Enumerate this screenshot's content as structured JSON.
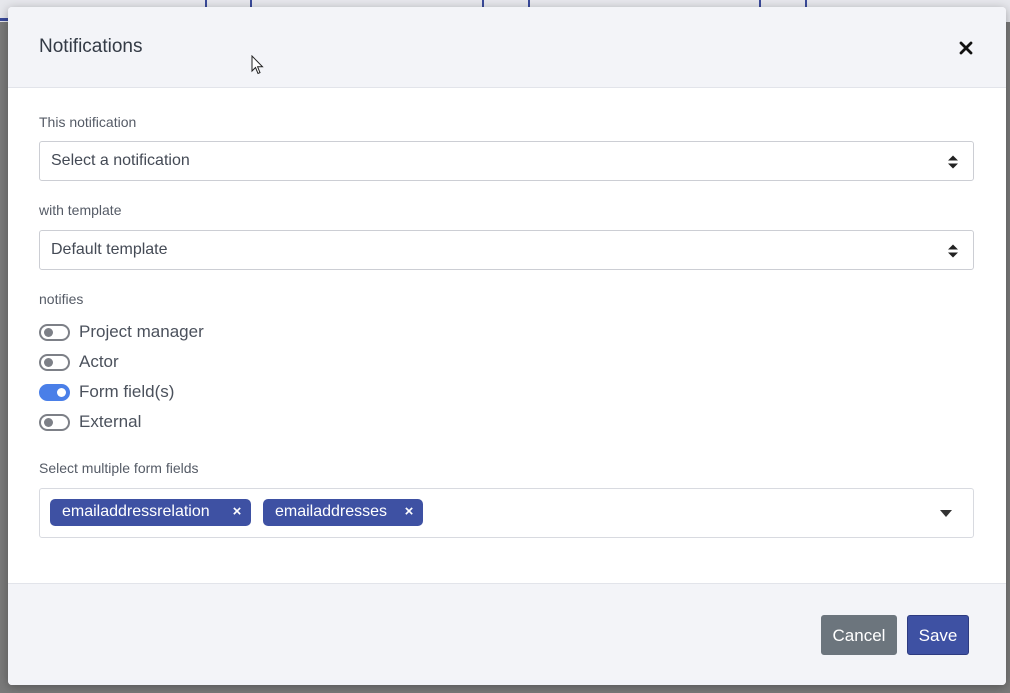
{
  "modal": {
    "title": "Notifications",
    "close_icon": "close-icon"
  },
  "notification": {
    "label": "This notification",
    "value": "Select a notification"
  },
  "template": {
    "label": "with template",
    "value": "Default template"
  },
  "notifies": {
    "label": "notifies",
    "options": [
      {
        "label": "Project manager",
        "checked": false
      },
      {
        "label": "Actor",
        "checked": false
      },
      {
        "label": "Form field(s)",
        "checked": true
      },
      {
        "label": "External",
        "checked": false
      }
    ]
  },
  "form_fields": {
    "label": "Select multiple form fields",
    "tags": [
      "emailaddressrelation",
      "emailaddresses"
    ],
    "remove_symbol": "×"
  },
  "footer": {
    "cancel_label": "Cancel",
    "save_label": "Save"
  },
  "colors": {
    "accent": "#3e51a3",
    "toggle_on": "#4a7fe8",
    "cancel": "#6c757d"
  }
}
